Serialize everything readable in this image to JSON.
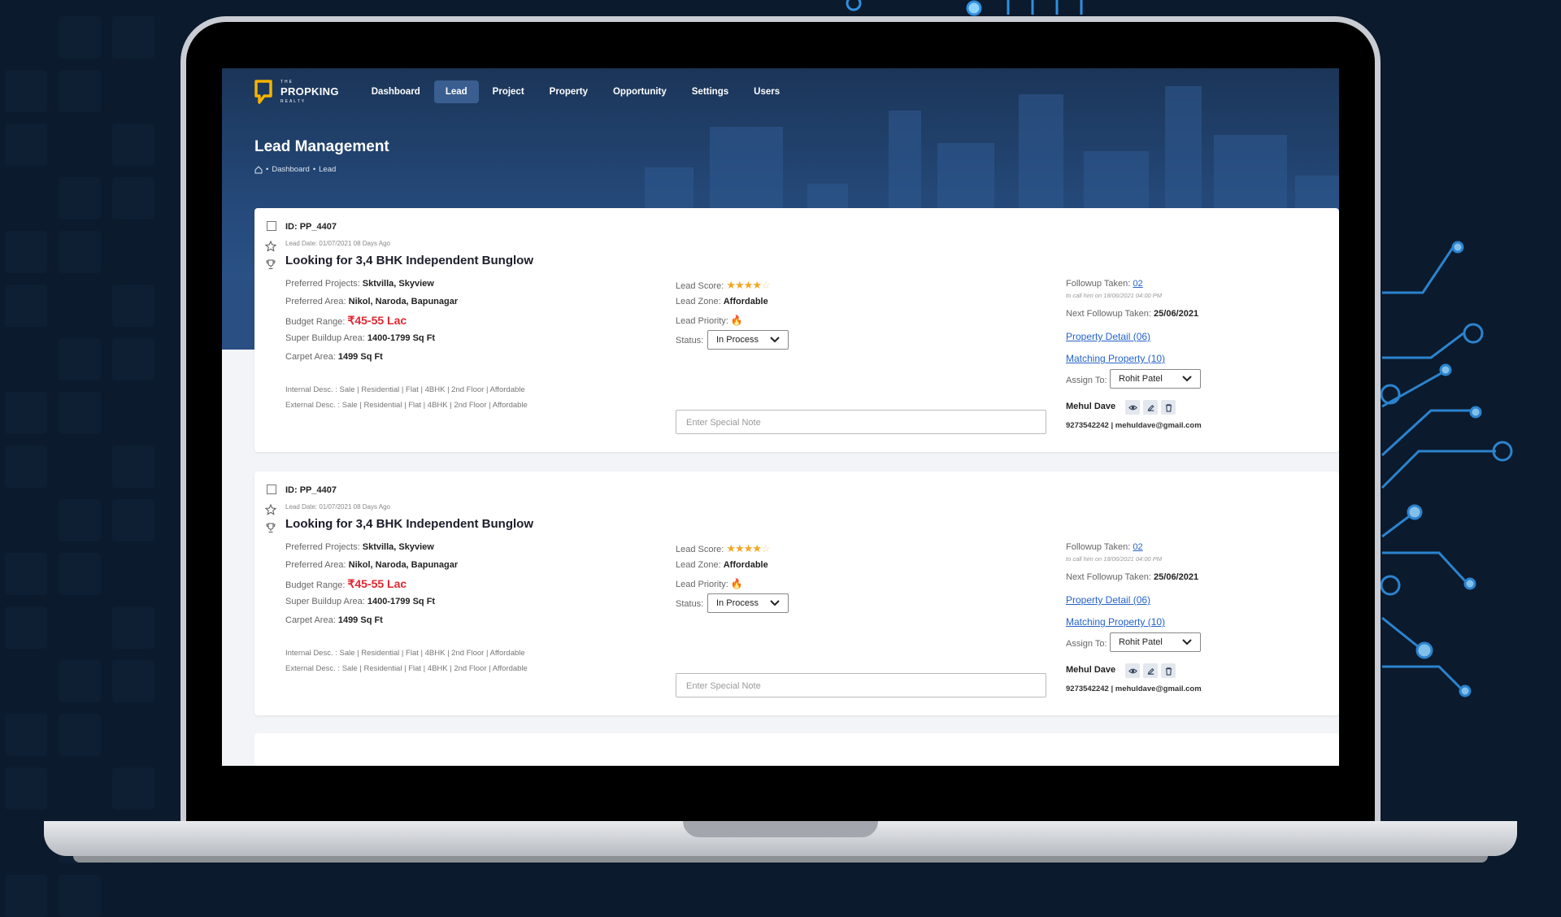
{
  "nav": {
    "logo_line1": "THE",
    "logo_line2": "PROPKING",
    "logo_line3": "REALTY",
    "items": [
      {
        "label": "Dashboard",
        "active": false
      },
      {
        "label": "Lead",
        "active": true
      },
      {
        "label": "Project",
        "active": false
      },
      {
        "label": "Property",
        "active": false
      },
      {
        "label": "Opportunity",
        "active": false
      },
      {
        "label": "Settings",
        "active": false
      },
      {
        "label": "Users",
        "active": false
      }
    ]
  },
  "page": {
    "title": "Lead Management",
    "breadcrumb": [
      "Dashboard",
      "Lead"
    ]
  },
  "colors": {
    "accent": "#2563c9",
    "price": "#e0262f",
    "hero": "#244878",
    "star": "#f5a623"
  },
  "leads": [
    {
      "id": "ID: PP_4407",
      "date": "Lead Date: 01/07/2021 08 Days Ago",
      "title": "Looking for 3,4 BHK Independent Bunglow",
      "projects_label": "Preferred Projects:",
      "projects": "Sktvilla, Skyview",
      "area_label": "Preferred Area:",
      "area": "Nikol, Naroda, Bapunagar",
      "budget_label": "Budget Range:",
      "budget": "₹45-55 Lac",
      "super_label": "Super Buildup Area:",
      "super": "1400-1799 Sq Ft",
      "carpet_label": "Carpet Area:",
      "carpet": "1499 Sq Ft",
      "internal_desc": "Internal Desc. : Sale | Residential | Flat | 4BHK | 2nd Floor | Affordable",
      "external_desc": "External Desc. : Sale | Residential | Flat | 4BHK | 2nd Floor | Affordable",
      "score_label": "Lead Score:",
      "score": 4,
      "zone_label": "Lead Zone:",
      "zone": "Affordable",
      "priority_label": "Lead Priority:",
      "priority_icon": "flame-icon",
      "status_label": "Status:",
      "status": "In Process",
      "note_placeholder": "Enter Special Note",
      "followup_label": "Followup Taken:",
      "followup": "02",
      "followup_note": "to call him on 18/06/2021 04:00 PM",
      "next_label": "Next Followup Taken:",
      "next": "25/06/2021",
      "property_detail": "Property Detail (06)",
      "matching_property": "Matching Property (10)",
      "assign_label": "Assign To:",
      "assign": "Rohit Patel",
      "contact_name": "Mehul Dave",
      "contact_info": "9273542242 | mehuldave@gmail.com"
    },
    {
      "id": "ID: PP_4407",
      "date": "Lead Date: 01/07/2021 08 Days Ago",
      "title": "Looking for 3,4 BHK Independent Bunglow",
      "projects_label": "Preferred Projects:",
      "projects": "Sktvilla, Skyview",
      "area_label": "Preferred Area:",
      "area": "Nikol, Naroda, Bapunagar",
      "budget_label": "Budget Range:",
      "budget": "₹45-55 Lac",
      "super_label": "Super Buildup Area:",
      "super": "1400-1799 Sq Ft",
      "carpet_label": "Carpet Area:",
      "carpet": "1499 Sq Ft",
      "internal_desc": "Internal Desc. : Sale | Residential | Flat | 4BHK | 2nd Floor | Affordable",
      "external_desc": "External Desc. : Sale | Residential | Flat | 4BHK | 2nd Floor | Affordable",
      "score_label": "Lead Score:",
      "score": 4,
      "zone_label": "Lead Zone:",
      "zone": "Affordable",
      "priority_label": "Lead Priority:",
      "priority_icon": "flame-icon",
      "status_label": "Status:",
      "status": "In Process",
      "note_placeholder": "Enter Special Note",
      "followup_label": "Followup Taken:",
      "followup": "02",
      "followup_note": "to call him on 18/06/2021 04:00 PM",
      "next_label": "Next Followup Taken:",
      "next": "25/06/2021",
      "property_detail": "Property Detail (06)",
      "matching_property": "Matching Property (10)",
      "assign_label": "Assign To:",
      "assign": "Rohit Patel",
      "contact_name": "Mehul Dave",
      "contact_info": "9273542242 | mehuldave@gmail.com"
    }
  ]
}
